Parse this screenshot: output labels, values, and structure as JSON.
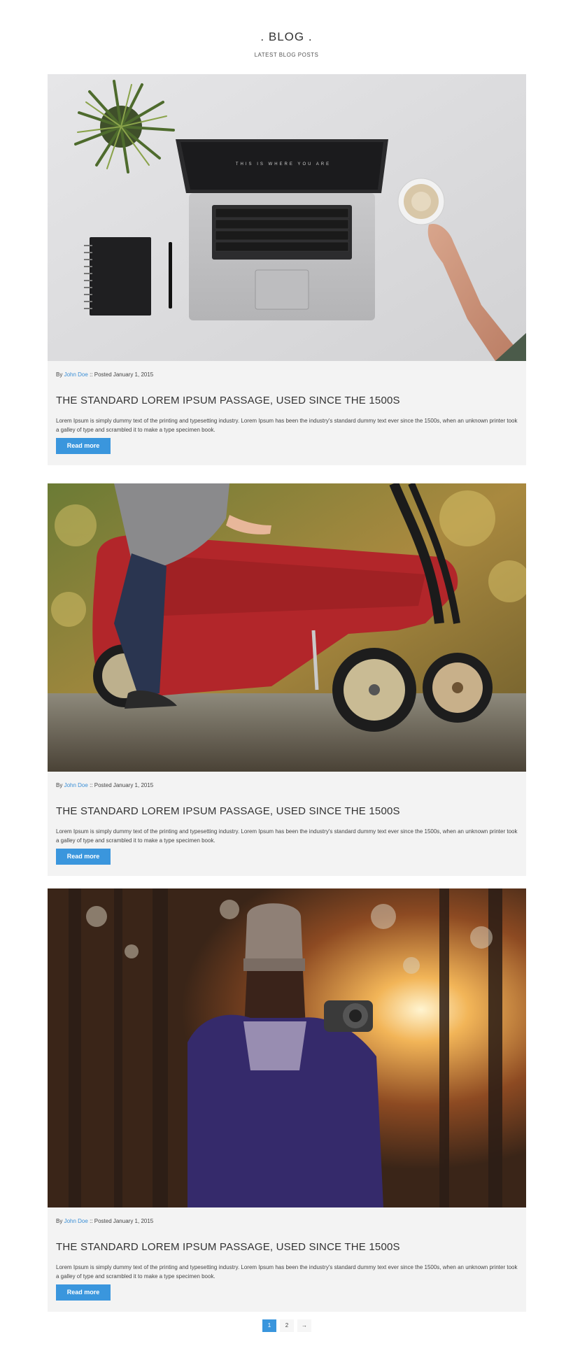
{
  "header": {
    "title": ". BLOG .",
    "subtitle": "LATEST BLOG POSTS"
  },
  "posts": [
    {
      "by": "By",
      "author": "John Doe",
      "posted": ":: Posted January 1, 2015",
      "title": "THE STANDARD LOREM IPSUM PASSAGE, USED SINCE THE 1500S",
      "excerpt": "Lorem Ipsum is simply dummy text of the printing and typesetting industry. Lorem Ipsum has been the industry's standard dummy text ever since the 1500s, when an unknown printer took a galley of type and scrambled it to make a type specimen book.",
      "button": "Read more",
      "laptop_screen_text": "THIS IS WHERE YOU ARE"
    },
    {
      "by": "By",
      "author": "John Doe",
      "posted": ":: Posted January 1, 2015",
      "title": "THE STANDARD LOREM IPSUM PASSAGE, USED SINCE THE 1500S",
      "excerpt": "Lorem Ipsum is simply dummy text of the printing and typesetting industry. Lorem Ipsum has been the industry's standard dummy text ever since the 1500s, when an unknown printer took a galley of type and scrambled it to make a type specimen book.",
      "button": "Read more"
    },
    {
      "by": "By",
      "author": "John Doe",
      "posted": ":: Posted January 1, 2015",
      "title": "THE STANDARD LOREM IPSUM PASSAGE, USED SINCE THE 1500S",
      "excerpt": "Lorem Ipsum is simply dummy text of the printing and typesetting industry. Lorem Ipsum has been the industry's standard dummy text ever since the 1500s, when an unknown printer took a galley of type and scrambled it to make a type specimen book.",
      "button": "Read more"
    }
  ],
  "pagination": {
    "pages": [
      "1",
      "2"
    ],
    "next": "→",
    "active": "1"
  },
  "colors": {
    "accent": "#3a96dd",
    "card_bg": "#f3f3f3",
    "author_link": "#3a8ed6"
  },
  "icons": {
    "next": "arrow-right-icon"
  }
}
